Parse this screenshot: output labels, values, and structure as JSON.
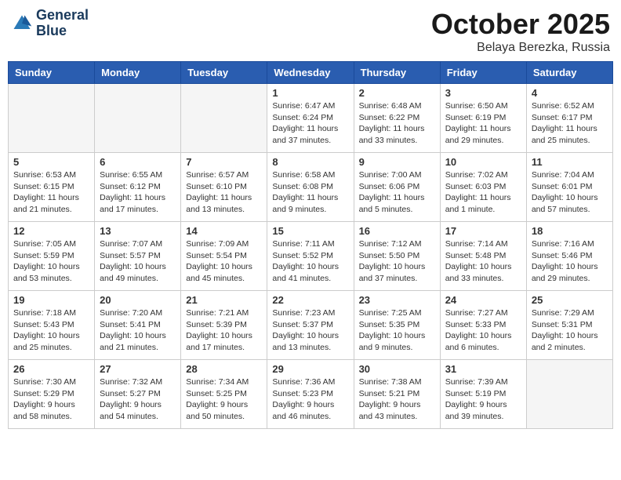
{
  "header": {
    "logo_line1": "General",
    "logo_line2": "Blue",
    "month_title": "October 2025",
    "subtitle": "Belaya Berezka, Russia"
  },
  "weekdays": [
    "Sunday",
    "Monday",
    "Tuesday",
    "Wednesday",
    "Thursday",
    "Friday",
    "Saturday"
  ],
  "weeks": [
    [
      {
        "day": "",
        "info": ""
      },
      {
        "day": "",
        "info": ""
      },
      {
        "day": "",
        "info": ""
      },
      {
        "day": "1",
        "info": "Sunrise: 6:47 AM\nSunset: 6:24 PM\nDaylight: 11 hours\nand 37 minutes."
      },
      {
        "day": "2",
        "info": "Sunrise: 6:48 AM\nSunset: 6:22 PM\nDaylight: 11 hours\nand 33 minutes."
      },
      {
        "day": "3",
        "info": "Sunrise: 6:50 AM\nSunset: 6:19 PM\nDaylight: 11 hours\nand 29 minutes."
      },
      {
        "day": "4",
        "info": "Sunrise: 6:52 AM\nSunset: 6:17 PM\nDaylight: 11 hours\nand 25 minutes."
      }
    ],
    [
      {
        "day": "5",
        "info": "Sunrise: 6:53 AM\nSunset: 6:15 PM\nDaylight: 11 hours\nand 21 minutes."
      },
      {
        "day": "6",
        "info": "Sunrise: 6:55 AM\nSunset: 6:12 PM\nDaylight: 11 hours\nand 17 minutes."
      },
      {
        "day": "7",
        "info": "Sunrise: 6:57 AM\nSunset: 6:10 PM\nDaylight: 11 hours\nand 13 minutes."
      },
      {
        "day": "8",
        "info": "Sunrise: 6:58 AM\nSunset: 6:08 PM\nDaylight: 11 hours\nand 9 minutes."
      },
      {
        "day": "9",
        "info": "Sunrise: 7:00 AM\nSunset: 6:06 PM\nDaylight: 11 hours\nand 5 minutes."
      },
      {
        "day": "10",
        "info": "Sunrise: 7:02 AM\nSunset: 6:03 PM\nDaylight: 11 hours\nand 1 minute."
      },
      {
        "day": "11",
        "info": "Sunrise: 7:04 AM\nSunset: 6:01 PM\nDaylight: 10 hours\nand 57 minutes."
      }
    ],
    [
      {
        "day": "12",
        "info": "Sunrise: 7:05 AM\nSunset: 5:59 PM\nDaylight: 10 hours\nand 53 minutes."
      },
      {
        "day": "13",
        "info": "Sunrise: 7:07 AM\nSunset: 5:57 PM\nDaylight: 10 hours\nand 49 minutes."
      },
      {
        "day": "14",
        "info": "Sunrise: 7:09 AM\nSunset: 5:54 PM\nDaylight: 10 hours\nand 45 minutes."
      },
      {
        "day": "15",
        "info": "Sunrise: 7:11 AM\nSunset: 5:52 PM\nDaylight: 10 hours\nand 41 minutes."
      },
      {
        "day": "16",
        "info": "Sunrise: 7:12 AM\nSunset: 5:50 PM\nDaylight: 10 hours\nand 37 minutes."
      },
      {
        "day": "17",
        "info": "Sunrise: 7:14 AM\nSunset: 5:48 PM\nDaylight: 10 hours\nand 33 minutes."
      },
      {
        "day": "18",
        "info": "Sunrise: 7:16 AM\nSunset: 5:46 PM\nDaylight: 10 hours\nand 29 minutes."
      }
    ],
    [
      {
        "day": "19",
        "info": "Sunrise: 7:18 AM\nSunset: 5:43 PM\nDaylight: 10 hours\nand 25 minutes."
      },
      {
        "day": "20",
        "info": "Sunrise: 7:20 AM\nSunset: 5:41 PM\nDaylight: 10 hours\nand 21 minutes."
      },
      {
        "day": "21",
        "info": "Sunrise: 7:21 AM\nSunset: 5:39 PM\nDaylight: 10 hours\nand 17 minutes."
      },
      {
        "day": "22",
        "info": "Sunrise: 7:23 AM\nSunset: 5:37 PM\nDaylight: 10 hours\nand 13 minutes."
      },
      {
        "day": "23",
        "info": "Sunrise: 7:25 AM\nSunset: 5:35 PM\nDaylight: 10 hours\nand 9 minutes."
      },
      {
        "day": "24",
        "info": "Sunrise: 7:27 AM\nSunset: 5:33 PM\nDaylight: 10 hours\nand 6 minutes."
      },
      {
        "day": "25",
        "info": "Sunrise: 7:29 AM\nSunset: 5:31 PM\nDaylight: 10 hours\nand 2 minutes."
      }
    ],
    [
      {
        "day": "26",
        "info": "Sunrise: 7:30 AM\nSunset: 5:29 PM\nDaylight: 9 hours\nand 58 minutes."
      },
      {
        "day": "27",
        "info": "Sunrise: 7:32 AM\nSunset: 5:27 PM\nDaylight: 9 hours\nand 54 minutes."
      },
      {
        "day": "28",
        "info": "Sunrise: 7:34 AM\nSunset: 5:25 PM\nDaylight: 9 hours\nand 50 minutes."
      },
      {
        "day": "29",
        "info": "Sunrise: 7:36 AM\nSunset: 5:23 PM\nDaylight: 9 hours\nand 46 minutes."
      },
      {
        "day": "30",
        "info": "Sunrise: 7:38 AM\nSunset: 5:21 PM\nDaylight: 9 hours\nand 43 minutes."
      },
      {
        "day": "31",
        "info": "Sunrise: 7:39 AM\nSunset: 5:19 PM\nDaylight: 9 hours\nand 39 minutes."
      },
      {
        "day": "",
        "info": ""
      }
    ]
  ]
}
